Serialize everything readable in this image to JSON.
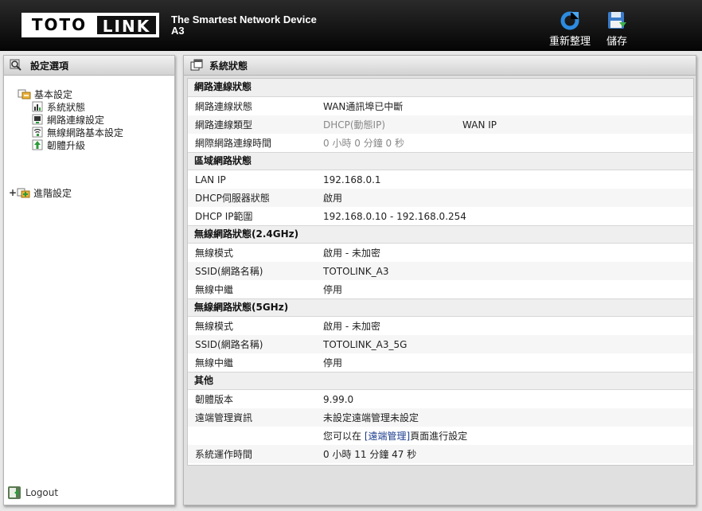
{
  "header": {
    "logo_left": "TOTO",
    "logo_right": "LINK",
    "tagline": "The Smartest Network Device",
    "model": "A3",
    "refresh_label": "重新整理",
    "save_label": "儲存"
  },
  "sidebar": {
    "title": "設定選項",
    "basic": {
      "label": "基本設定",
      "items": [
        {
          "label": "系統狀態",
          "icon": "bar-chart-icon"
        },
        {
          "label": "網路連線設定",
          "icon": "computer-icon"
        },
        {
          "label": "無線網路基本設定",
          "icon": "wireless-icon"
        },
        {
          "label": "韌體升級",
          "icon": "upgrade-icon"
        }
      ]
    },
    "advanced": {
      "label": "進階設定"
    },
    "logout": "Logout"
  },
  "main": {
    "title": "系統狀態",
    "sections": {
      "network": {
        "title": "網路連線狀態",
        "status_key": "網路連線狀態",
        "status_val": "WAN通訊埠已中斷",
        "type_key": "網路連線類型",
        "type_val": "DHCP(動態IP)",
        "type_extra": "WAN IP",
        "time_key": "網際網路連線時間",
        "time_val": "0 小時 0 分鐘 0 秒"
      },
      "lan": {
        "title": "區域網路狀態",
        "ip_key": "LAN IP",
        "ip_val": "192.168.0.1",
        "dhcp_key": "DHCP伺服器狀態",
        "dhcp_val": "啟用",
        "range_key": "DHCP IP範圍",
        "range_val": "192.168.0.10 - 192.168.0.254"
      },
      "wifi24": {
        "title": "無線網路狀態(2.4GHz)",
        "mode_key": "無線模式",
        "mode_val": "啟用 - 未加密",
        "ssid_key": "SSID(網路名稱)",
        "ssid_val": "TOTOLINK_A3",
        "repeater_key": "無線中繼",
        "repeater_val": "停用"
      },
      "wifi5": {
        "title": "無線網路狀態(5GHz)",
        "mode_key": "無線模式",
        "mode_val": "啟用 - 未加密",
        "ssid_key": "SSID(網路名稱)",
        "ssid_val": "TOTOLINK_A3_5G",
        "repeater_key": "無線中繼",
        "repeater_val": "停用"
      },
      "other": {
        "title": "其他",
        "fw_key": "韌體版本",
        "fw_val": "9.99.0",
        "remote_key": "遠端管理資訊",
        "remote_val": "未設定遠端管理未設定",
        "remote_hint_pre": "您可以在 ",
        "remote_hint_link": "[遠端管理]",
        "remote_hint_post": "頁面進行設定",
        "uptime_key": "系統運作時間",
        "uptime_val": "0 小時 11 分鐘 47 秒"
      }
    }
  }
}
